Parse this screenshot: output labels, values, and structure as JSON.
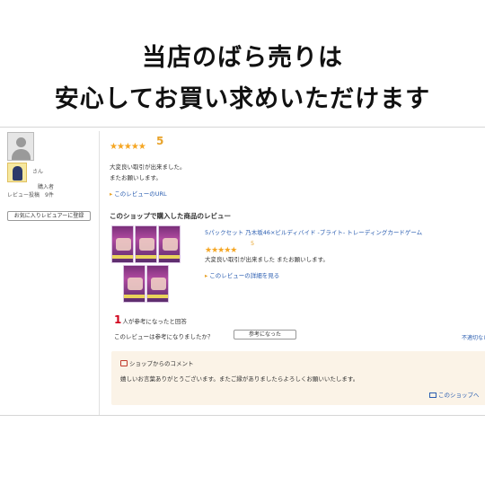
{
  "banner": {
    "line1": "当店のばら売りは",
    "line2": "安心してお買い求めいただけます"
  },
  "reviewer": {
    "name_suffix": "さん",
    "purchaser_label": "購入者",
    "review_count": "レビュー投稿　9件",
    "favorite_button": "お気に入りレビュアーに登録"
  },
  "review": {
    "stars": "★★★★★",
    "rating": "5",
    "text_line1": "大変良い取引が出来ました。",
    "text_line2": "またお願いします。",
    "url_link": "このレビューのURL"
  },
  "products_section": {
    "heading": "このショップで購入した商品のレビュー",
    "product": {
      "title": "5パックセット 乃木坂46×ビルディバイド -ブライト- トレーディングカードゲーム",
      "stars": "★★★★★",
      "rating": "5",
      "review_text": "大変良い取引が出来ました またお願いします。",
      "detail_link": "このレビューの詳細を見る",
      "pack_count": 5
    }
  },
  "helpful": {
    "count": "1",
    "count_suffix": "人が参考になったと回答",
    "question": "このレビューは参考になりましたか？",
    "button": "参考になった",
    "report_link": "不適切なレビューを報告"
  },
  "shop_comment": {
    "title": "ショップからのコメント",
    "text": "嬉しいお言葉ありがとうございます。またご縁がありましたらよろしくお願いいたします。",
    "link": "このショップへ"
  },
  "colors": {
    "star": "#f5a623",
    "link": "#2a5db0",
    "helpful_count": "#d0021b",
    "comment_bg": "#fbf3e7"
  }
}
